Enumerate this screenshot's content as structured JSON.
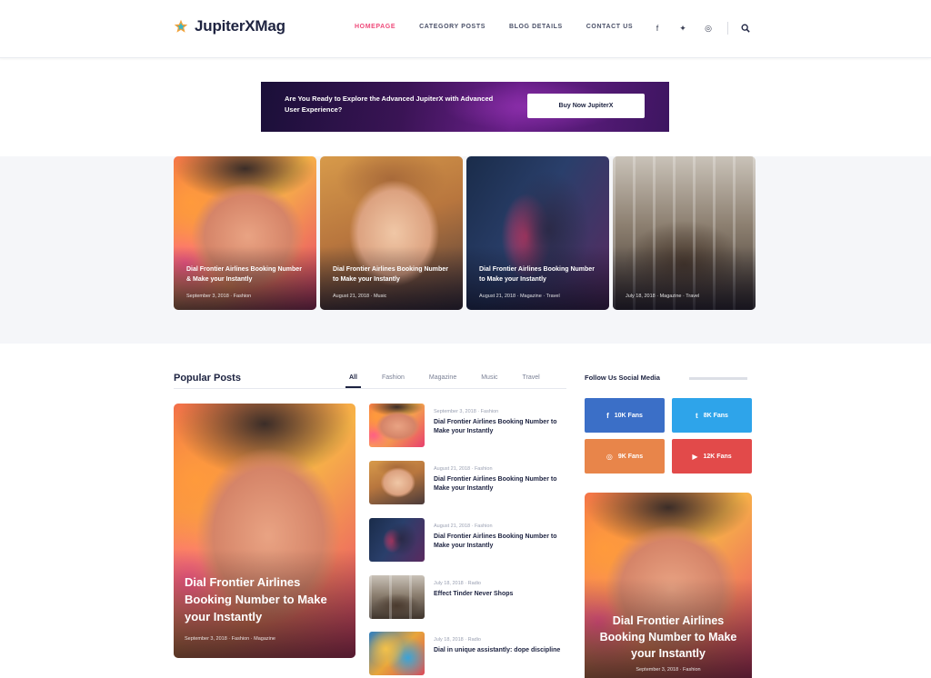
{
  "header": {
    "logo_text": "JupiterXMag",
    "nav": [
      {
        "label": "HOMEPAGE",
        "active": true
      },
      {
        "label": "CATEGORY POSTS",
        "active": false
      },
      {
        "label": "BLOG DETAILS",
        "active": false
      },
      {
        "label": "CONTACT US",
        "active": false
      }
    ],
    "social_icons": [
      "facebook-icon",
      "twitter-icon",
      "instagram-icon"
    ],
    "search_icon": "search-icon",
    "accent_color": "#ef4a7a"
  },
  "banner": {
    "text": "Are You Ready to Explore the Advanced JupiterX with Advanced User Experience?",
    "button_label": "Buy Now JupiterX"
  },
  "featured": [
    {
      "title": "Dial Frontier Airlines Booking Number & Make your Instantly",
      "meta": "September 3, 2018 · Fashion"
    },
    {
      "title": "Dial Frontier Airlines Booking Number to Make your Instantly",
      "meta": "August 21, 2018 · Music"
    },
    {
      "title": "Dial Frontier Airlines Booking Number to Make your Instantly",
      "meta": "August 21, 2018 · Magazine · Travel"
    },
    {
      "title": "",
      "meta": "July 18, 2018 · Magazine · Travel"
    }
  ],
  "popular": {
    "title": "Popular Posts",
    "tabs": [
      {
        "label": "All",
        "active": true
      },
      {
        "label": "Fashion",
        "active": false
      },
      {
        "label": "Magazine",
        "active": false
      },
      {
        "label": "Music",
        "active": false
      },
      {
        "label": "Travel",
        "active": false
      }
    ],
    "big": {
      "title": "Dial Frontier Airlines Booking Number to Make your Instantly",
      "meta": "September 3, 2018 · Fashion · Magazine"
    },
    "list": [
      {
        "meta": "September 3, 2018 · Fashion",
        "title": "Dial Frontier Airlines Booking Number to Make your Instantly"
      },
      {
        "meta": "August 21, 2018 · Fashion",
        "title": "Dial Frontier Airlines Booking Number to Make your Instantly"
      },
      {
        "meta": "August 21, 2018 · Fashion",
        "title": "Dial Frontier Airlines Booking Number to Make your Instantly"
      },
      {
        "meta": "July 18, 2018 · Radio",
        "title": "Effect Tinder Never Shops"
      },
      {
        "meta": "July 18, 2018 · Radio",
        "title": "Dial in unique assistantly: dope discipline"
      }
    ]
  },
  "sidebar": {
    "title": "Follow Us Social Media",
    "social": [
      {
        "name": "facebook",
        "icon": "facebook-icon",
        "glyph": "f",
        "label": "10K Fans",
        "color": "#3b6fc7"
      },
      {
        "name": "twitter",
        "icon": "twitter-icon",
        "glyph": "t",
        "label": "8K Fans",
        "color": "#2ea4ea"
      },
      {
        "name": "instagram",
        "icon": "instagram-icon",
        "glyph": "◎",
        "label": "9K Fans",
        "color": "#e8854a"
      },
      {
        "name": "youtube",
        "icon": "youtube-icon",
        "glyph": "▶",
        "label": "12K Fans",
        "color": "#e24a4a"
      }
    ],
    "card": {
      "title": "Dial Frontier Airlines Booking Number to Make your Instantly",
      "meta": "September 3, 2018 · Fashion"
    }
  }
}
